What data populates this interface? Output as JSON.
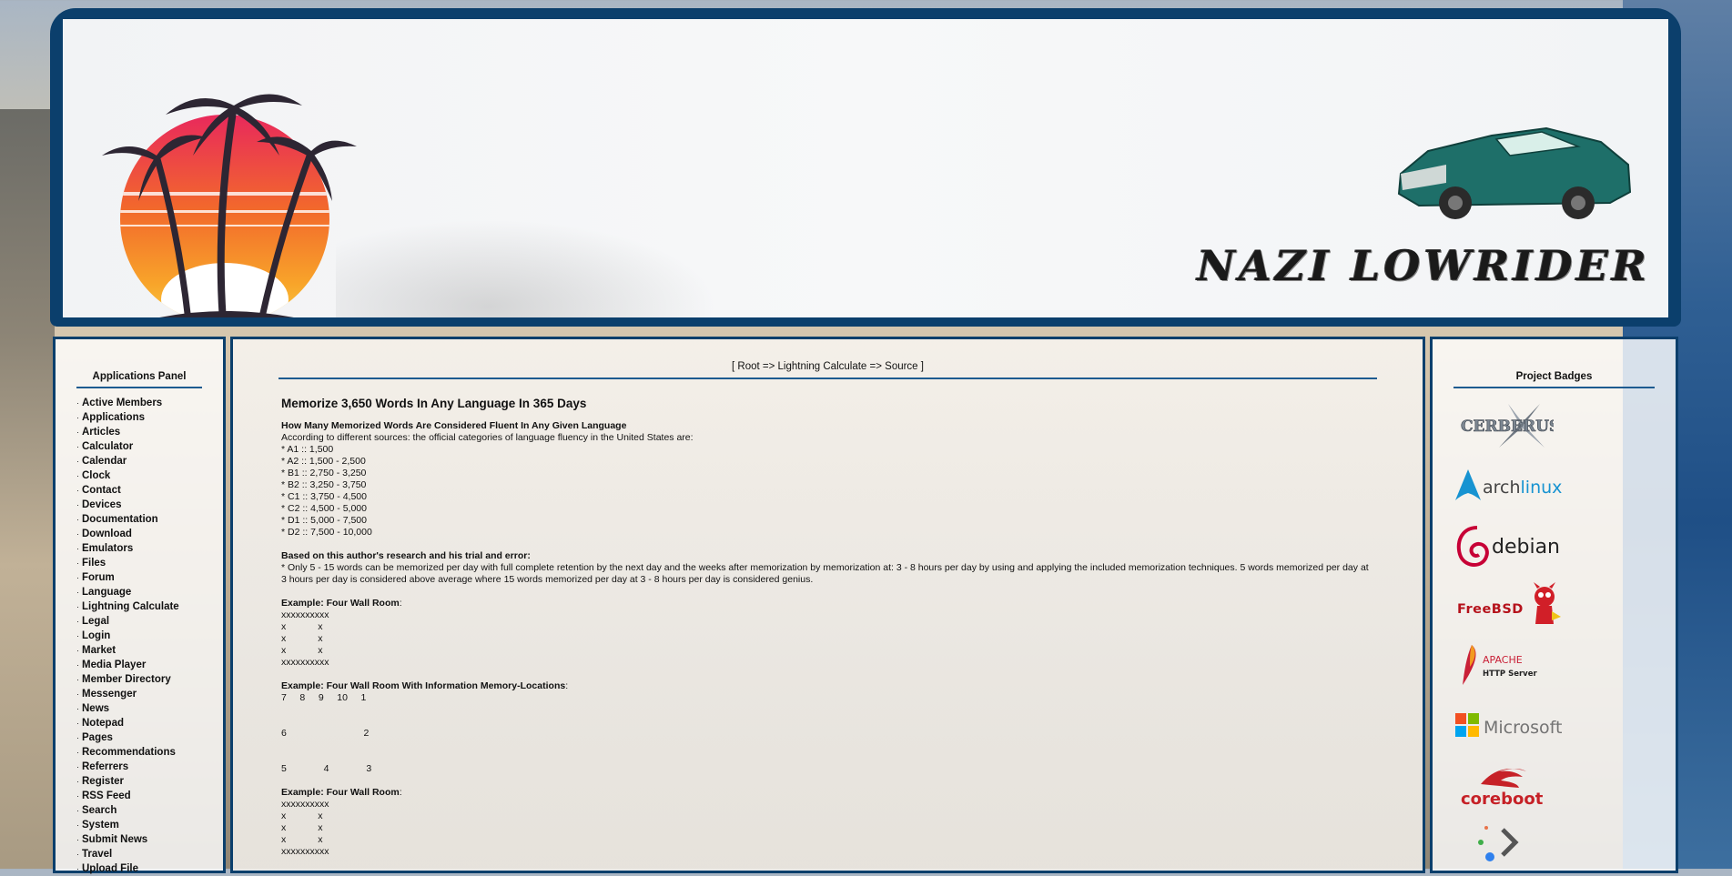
{
  "header": {
    "site_title": "NAZI LOWRIDER"
  },
  "left_panel": {
    "title": "Applications Panel",
    "items": [
      "Active Members",
      "Applications",
      "Articles",
      "Calculator",
      "Calendar",
      "Clock",
      "Contact",
      "Devices",
      "Documentation",
      "Download",
      "Emulators",
      "Files",
      "Forum",
      "Language",
      "Lightning Calculate",
      "Legal",
      "Login",
      "Market",
      "Media Player",
      "Member Directory",
      "Messenger",
      "News",
      "Notepad",
      "Pages",
      "Recommendations",
      "Referrers",
      "Register",
      "RSS Feed",
      "Search",
      "System",
      "Submit News",
      "Travel",
      "Upload File"
    ]
  },
  "main": {
    "breadcrumb": "[ Root => Lightning Calculate => Source ]",
    "heading": "Memorize 3,650 Words In Any Language In 365 Days",
    "section1": {
      "title": "How Many Memorized Words Are Considered Fluent In Any Given Language",
      "intro": "According to different sources: the official categories of language fluency in the United States are:",
      "levels": [
        "* A1 :: 1,500",
        "* A2 :: 1,500 - 2,500",
        "* B1 :: 2,750 - 3,250",
        "* B2 :: 3,250 - 3,750",
        "* C1 :: 3,750 - 4,500",
        "* C2 :: 4,500 - 5,000",
        "* D1 :: 5,000 - 7,500",
        "* D2 :: 7,500 - 10,000"
      ]
    },
    "section2": {
      "title": "Based on this author's research and his trial and error:",
      "text": "* Only 5 - 15 words can be memorized per day with full complete retention by the next day and the weeks after memorization by memorization at: 3 - 8 hours per day by using and applying the included memorization techniques. 5 words memorized per day at 3 hours per day is considered above average where 15 words memorized per day at 3 - 8 hours per day is considered genius."
    },
    "example1": {
      "title": "Example: Four Wall Room",
      "suffix": ":",
      "rows": [
        "xxxxxxxxxx",
        "x            x",
        "x            x",
        "x            x",
        "xxxxxxxxxx"
      ]
    },
    "example2": {
      "title": "Example: Four Wall Room With Information Memory-Locations",
      "suffix": ":",
      "row_top": "7     8     9     10     1",
      "row_mid": "6                             2",
      "row_bottom": "5              4              3"
    },
    "example3": {
      "title": "Example: Four Wall Room",
      "suffix": ":",
      "rows": [
        "xxxxxxxxxx",
        "x            x",
        "x            x",
        "x            x",
        "xxxxxxxxxx"
      ]
    }
  },
  "right_panel": {
    "title": "Project Badges",
    "badges": [
      {
        "name": "cerberus",
        "label": "CERBERUS"
      },
      {
        "name": "archlinux",
        "label": "archlinux"
      },
      {
        "name": "debian",
        "label": "debian"
      },
      {
        "name": "freebsd",
        "label": "FreeBSD"
      },
      {
        "name": "apache",
        "label": "APACHE",
        "sublabel": "HTTP Server"
      },
      {
        "name": "microsoft",
        "label": "Microsoft"
      },
      {
        "name": "coreboot",
        "label": "coreboot"
      },
      {
        "name": "arrow",
        "label": ""
      }
    ]
  }
}
